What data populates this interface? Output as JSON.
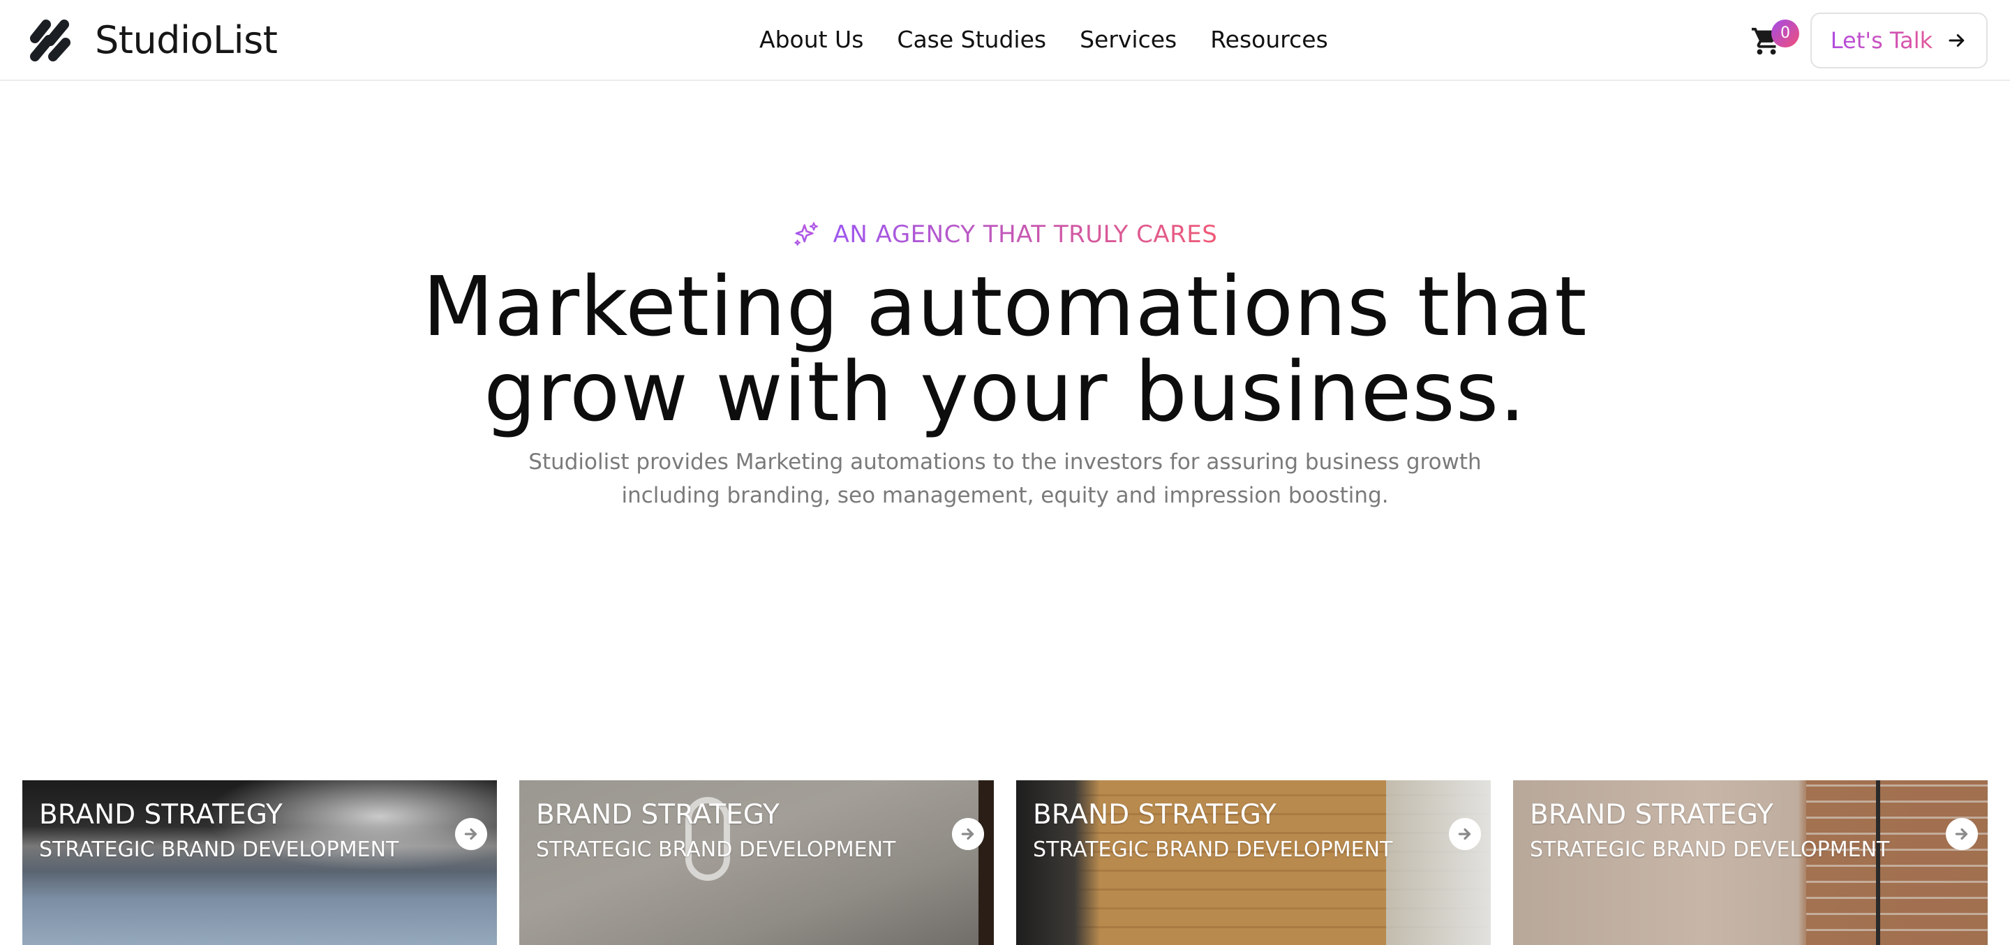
{
  "header": {
    "brand_name": "StudioList",
    "nav": [
      "About Us",
      "Case Studies",
      "Services",
      "Resources"
    ],
    "cart_count": "0",
    "cta_label": "Let's Talk"
  },
  "hero": {
    "eyebrow": "AN AGENCY THAT TRULY CARES",
    "headline_line1": "Marketing automations that",
    "headline_line2": "grow with your business.",
    "subtext_line1": "Studiolist provides Marketing automations to the investors for assuring business growth",
    "subtext_line2": "including branding, seo management, equity and impression boosting."
  },
  "cards": [
    {
      "title": "BRAND STRATEGY",
      "subtitle": "STRATEGIC BRAND DEVELOPMENT"
    },
    {
      "title": "BRAND STRATEGY",
      "subtitle": "STRATEGIC BRAND DEVELOPMENT"
    },
    {
      "title": "BRAND STRATEGY",
      "subtitle": "STRATEGIC BRAND DEVELOPMENT"
    },
    {
      "title": "BRAND STRATEGY",
      "subtitle": "STRATEGIC BRAND DEVELOPMENT"
    }
  ],
  "colors": {
    "accent_start": "#9d57f0",
    "accent_end": "#ef5a76",
    "text_primary": "#0d0d0d",
    "text_muted": "#7a7a7a"
  },
  "icons": {
    "logo": "studiolist-logo-mark",
    "cart": "shopping-cart-icon",
    "cta_arrow": "arrow-right-icon",
    "eyebrow": "sparkles-icon",
    "card_arrow": "circle-arrow-right-icon"
  }
}
